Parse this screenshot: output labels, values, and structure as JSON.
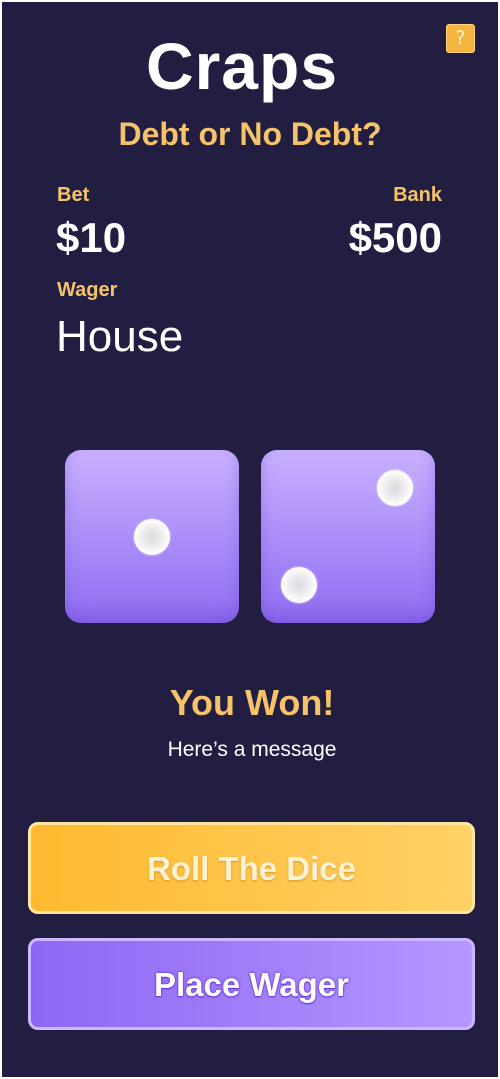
{
  "header": {
    "title": "Craps",
    "subtitle": "Debt or No Debt?",
    "help_label": "?"
  },
  "stats": {
    "bet_label": "Bet",
    "bet_value": "$10",
    "bank_label": "Bank",
    "bank_value": "$500",
    "wager_label": "Wager",
    "wager_value": "House"
  },
  "dice": {
    "left_value": 1,
    "right_value": 2
  },
  "result": {
    "title": "You Won!",
    "message": "Here’s a message"
  },
  "actions": {
    "roll_label": "Roll The Dice",
    "wager_label": "Place Wager"
  },
  "colors": {
    "background": "#221e42",
    "accent_gold": "#f6c36a",
    "die_purple": "#a688f7",
    "roll_button": "#ffc140",
    "wager_button": "#9f7bfa"
  }
}
